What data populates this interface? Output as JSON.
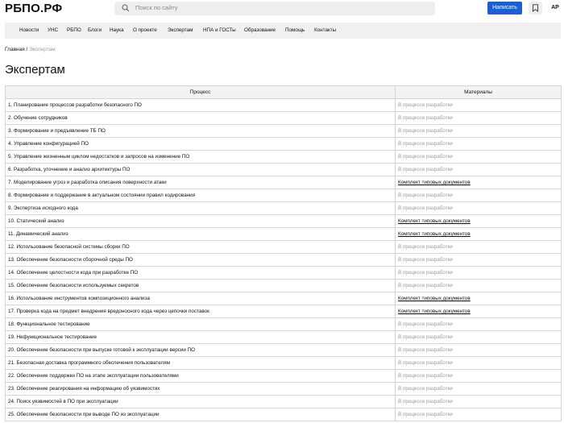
{
  "header": {
    "logo": "РБПО.РФ",
    "search_placeholder": "Поиск по сайту",
    "write_button": "Написать",
    "avatar": "АР"
  },
  "nav": [
    "Новости",
    "УНС",
    "РБПО",
    "Блоги",
    "Наука",
    "О проекте",
    "Экспертам",
    "НПА и ГОСТы",
    "Образование",
    "Помощь",
    "Контакты"
  ],
  "breadcrumb": {
    "home": "Главная",
    "separator": " / ",
    "current": "Экспертам"
  },
  "page_title": "Экспертам",
  "table": {
    "headers": [
      "Процесс",
      "Материалы"
    ],
    "rows": [
      {
        "process": "1. Планирование процессов разработки безопасного ПО",
        "material": "В процессе разработки",
        "link": false
      },
      {
        "process": "2. Обучение сотрудников",
        "material": "В процессе разработки",
        "link": false
      },
      {
        "process": "3. Формирование и предъявление ТБ ПО",
        "material": "В процессе разработки",
        "link": false
      },
      {
        "process": "4. Управление конфигурацией ПО",
        "material": "В процессе разработки",
        "link": false
      },
      {
        "process": "5. Управление жизненным циклом недостатков и запросов на изменение ПО",
        "material": "В процессе разработки",
        "link": false
      },
      {
        "process": "6. Разработка, уточнение и анализ архитектуры ПО",
        "material": "В процессе разработки",
        "link": false
      },
      {
        "process": "7. Моделирование угроз и разработка описания поверхности атаки",
        "material": "Комплект типовых документов",
        "link": true
      },
      {
        "process": "8. Формирование и поддержание в актуальном состоянии правил кодирования",
        "material": "В процессе разработки",
        "link": false
      },
      {
        "process": "9. Экспертиза исходного кода",
        "material": "В процессе разработки",
        "link": false
      },
      {
        "process": "10. Статический анализ",
        "material": "Комплект типовых документов",
        "link": true
      },
      {
        "process": "11. Динамический анализ",
        "material": "Комплект типовых документов",
        "link": true
      },
      {
        "process": "12. Использование безопасной системы сборки ПО",
        "material": "В процессе разработки",
        "link": false
      },
      {
        "process": "13. Обеспечение безопасности сборочной среды ПО",
        "material": "В процессе разработки",
        "link": false
      },
      {
        "process": "14. Обеспечение целостности кода при разработке ПО",
        "material": "В процессе разработки",
        "link": false
      },
      {
        "process": "15. Обеспечение безопасности используемых секретов",
        "material": "В процессе разработки",
        "link": false
      },
      {
        "process": "16. Использование инструментов композиционного анализа",
        "material": "Комплект типовых документов",
        "link": true
      },
      {
        "process": "17. Проверка кода на предмет внедрения вредоносного кода через цепочки поставок",
        "material": "Комплект типовых документов",
        "link": true
      },
      {
        "process": "18. Функциональное тестирование",
        "material": "В процессе разработки",
        "link": false
      },
      {
        "process": "19. Нефункциональное тестирование",
        "material": "В процессе разработки",
        "link": false
      },
      {
        "process": "20. Обеспечение безопасности при выпуске готовой к эксплуатации версии ПО",
        "material": "В процессе разработки",
        "link": false
      },
      {
        "process": "21. Безопасная доставка программного обеспечения пользователям",
        "material": "В процессе разработки",
        "link": false
      },
      {
        "process": "22. Обеспечение поддержки ПО на этапе эксплуатации пользователями",
        "material": "В процессе разработки",
        "link": false
      },
      {
        "process": "23. Обеспечение реагирования на информацию об уязвимостях",
        "material": "В процессе разработки",
        "link": false
      },
      {
        "process": "24. Поиск уязвимостей в ПО при эксплуатации",
        "material": "В процессе разработки",
        "link": false
      },
      {
        "process": "25. Обеспечение безопасности при выводе ПО из эксплуатации",
        "material": "В процессе разработки",
        "link": false
      }
    ]
  },
  "icons": {
    "search": "search-icon",
    "bookmark": "bookmark-icon"
  },
  "colors": {
    "accent": "#1a5fd6",
    "muted_text": "#9a9a9a",
    "nav_background": "#f0f0f0"
  }
}
